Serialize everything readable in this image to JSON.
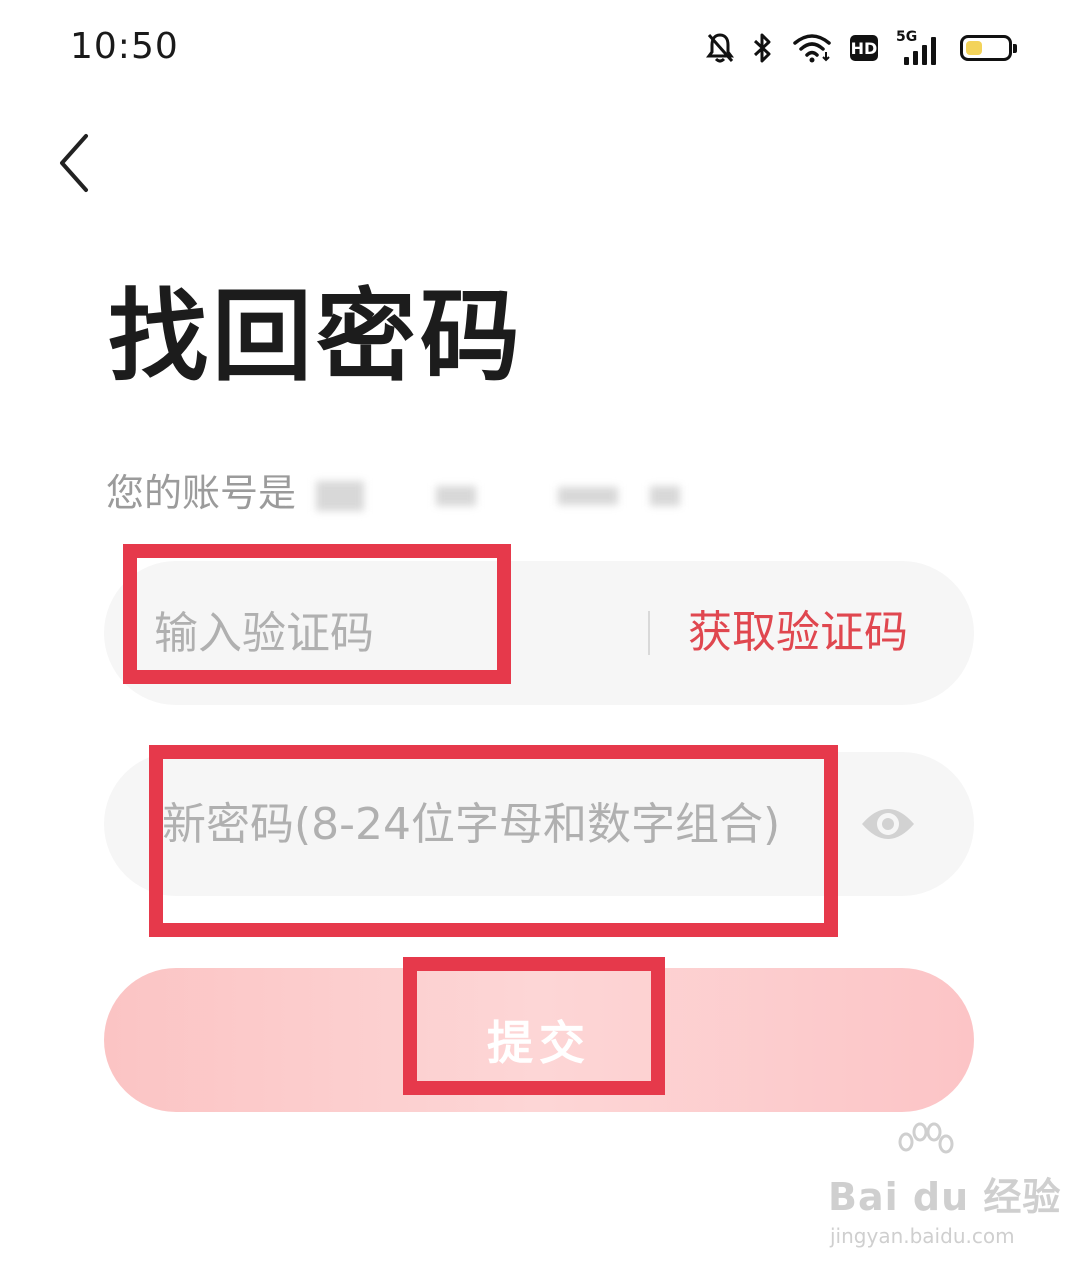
{
  "status_bar": {
    "time": "10:50",
    "icons": [
      "bell-off-icon",
      "bluetooth-icon",
      "wifi-icon",
      "hd-icon",
      "5g-signal-icon",
      "battery-icon"
    ],
    "hd_label": "HD",
    "network_label": "5G",
    "battery_level": 0.4
  },
  "header": {
    "back_icon": "chevron-left-icon"
  },
  "page": {
    "title": "找回密码",
    "account_prefix": "您的账号是"
  },
  "form": {
    "code_placeholder": "输入验证码",
    "get_code_label": "获取验证码",
    "password_placeholder": "新密码(8-24位字母和数字组合)",
    "eye_icon": "eye-icon",
    "submit_label": "提交"
  },
  "watermark": {
    "brand": "Bai du 经验",
    "url": "jingyan.baidu.com"
  },
  "colors": {
    "accent": "#e0474f",
    "annotation": "#e6394b",
    "field_bg": "#f6f6f6",
    "submit_bg": "#fcc9c9"
  }
}
